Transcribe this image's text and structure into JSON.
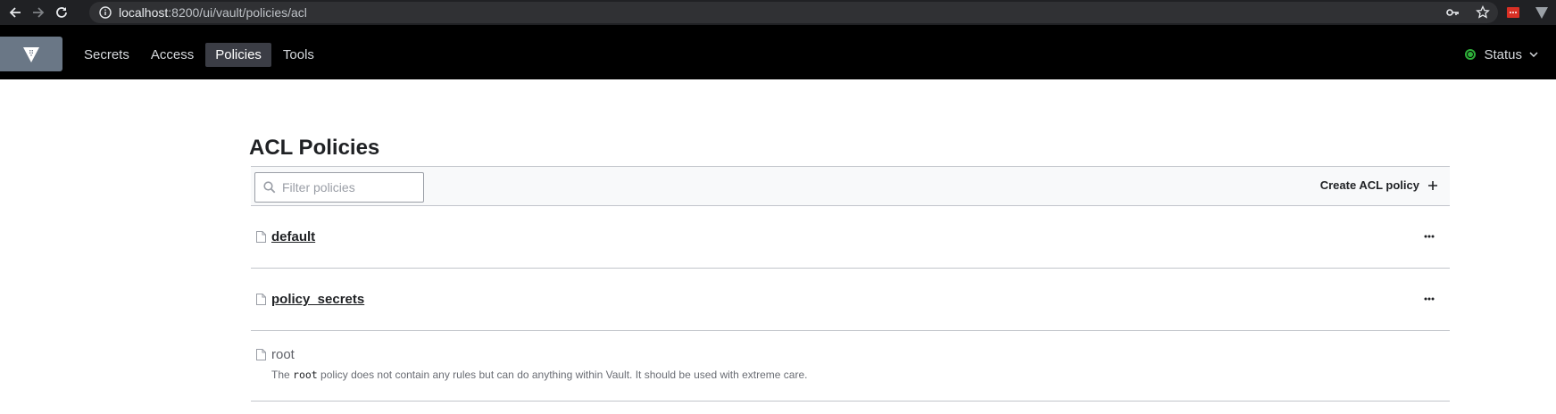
{
  "browser": {
    "url_host": "localhost",
    "url_path": ":8200/ui/vault/policies/acl",
    "icons": [
      "back-arrow-icon",
      "forward-arrow-icon",
      "reload-icon",
      "site-info-icon",
      "key-icon",
      "star-icon",
      "extension-icon",
      "vault-extension-icon"
    ]
  },
  "header": {
    "nav": [
      {
        "label": "Secrets",
        "active": false
      },
      {
        "label": "Access",
        "active": false
      },
      {
        "label": "Policies",
        "active": true
      },
      {
        "label": "Tools",
        "active": false
      }
    ],
    "status_label": "Status",
    "status_color": "#2eb039"
  },
  "page": {
    "title": "ACL Policies",
    "filter_placeholder": "Filter policies",
    "create_label": "Create ACL policy"
  },
  "policies": [
    {
      "name": "default"
    },
    {
      "name": "policy_secrets"
    }
  ],
  "root_policy": {
    "name": "root",
    "desc_before": "The ",
    "desc_code": "root",
    "desc_after": " policy does not contain any rules but can do anything within Vault. It should be used with extreme care."
  },
  "colors": {
    "header_bg": "#000000",
    "logo_bg": "#6a7786",
    "active_nav_bg": "#3b3d45"
  }
}
